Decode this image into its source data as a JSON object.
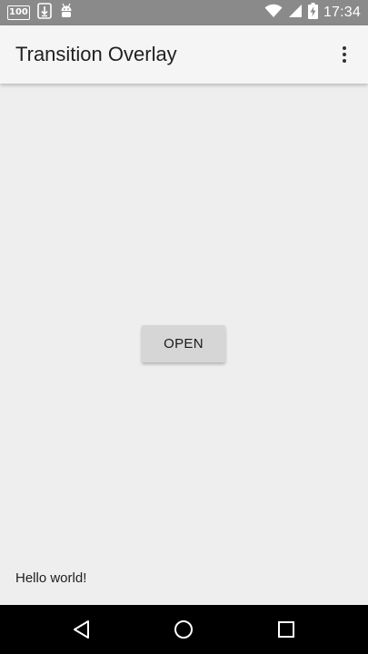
{
  "status_bar": {
    "notification_badge": "100",
    "icons": [
      "download-icon",
      "android-icon",
      "wifi-icon",
      "signal-icon",
      "battery-charging-icon"
    ],
    "time": "17:34"
  },
  "app_bar": {
    "title": "Transition Overlay",
    "overflow_icon": "more-vert-icon"
  },
  "main": {
    "open_button_label": "OPEN",
    "hello_text": "Hello world!"
  },
  "nav_bar": {
    "buttons": [
      "back-icon",
      "home-icon",
      "recents-icon"
    ]
  },
  "colors": {
    "status_bar": "#8a8a8a",
    "app_bar": "#f5f5f5",
    "background": "#eeeeee",
    "button": "#d6d6d6",
    "nav_bar": "#000000"
  }
}
